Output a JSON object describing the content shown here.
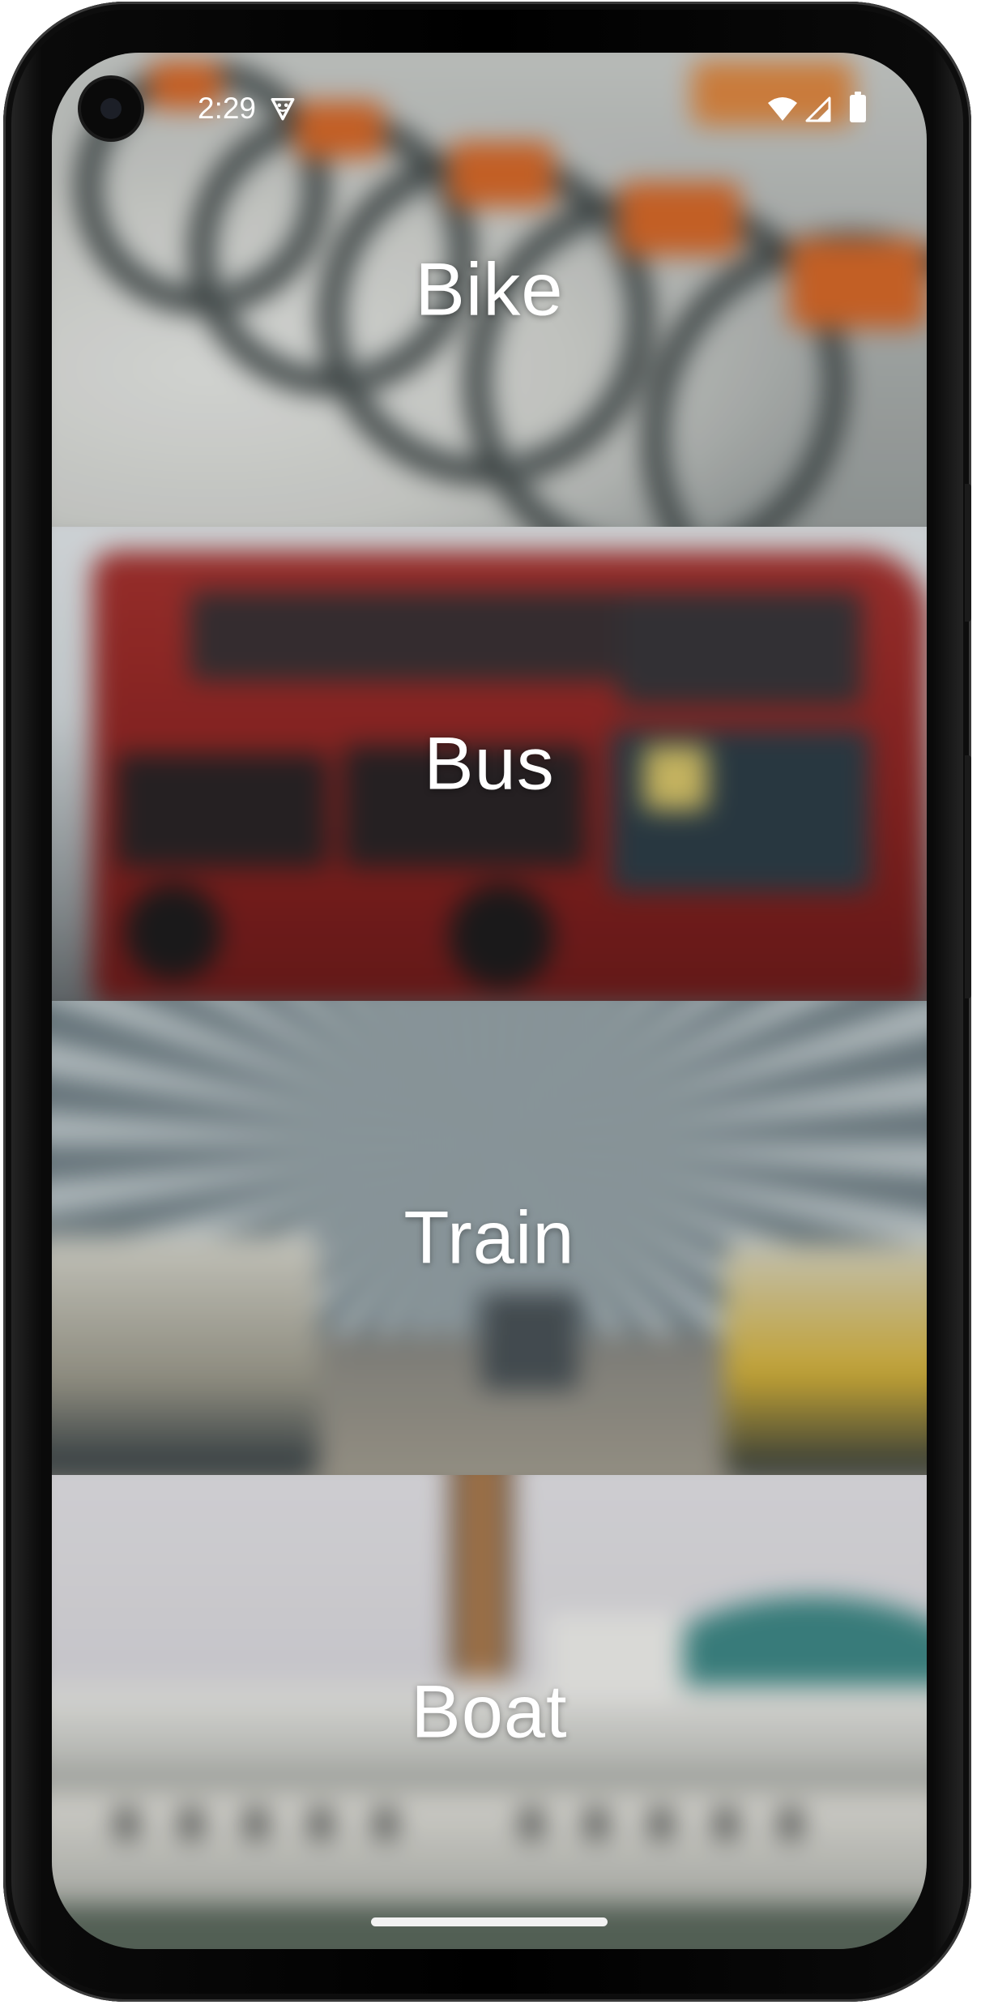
{
  "status_bar": {
    "time": "2:29",
    "icons": [
      "camera-cutout",
      "vpn-shield-icon",
      "wifi-icon",
      "cellular-icon",
      "battery-icon"
    ]
  },
  "tiles": [
    {
      "label": "Bike",
      "image": "blurred photo of a row of rental bicycles"
    },
    {
      "label": "Bus",
      "image": "blurred photo of a red double-decker bus"
    },
    {
      "label": "Train",
      "image": "blurred photo of a train station platform"
    },
    {
      "label": "Boat",
      "image": "blurred photo of a paddle steamer boat"
    }
  ],
  "colors": {
    "label_text": "#ffffff",
    "frame": "#000000",
    "nav_handle": "#f2f2f2"
  }
}
